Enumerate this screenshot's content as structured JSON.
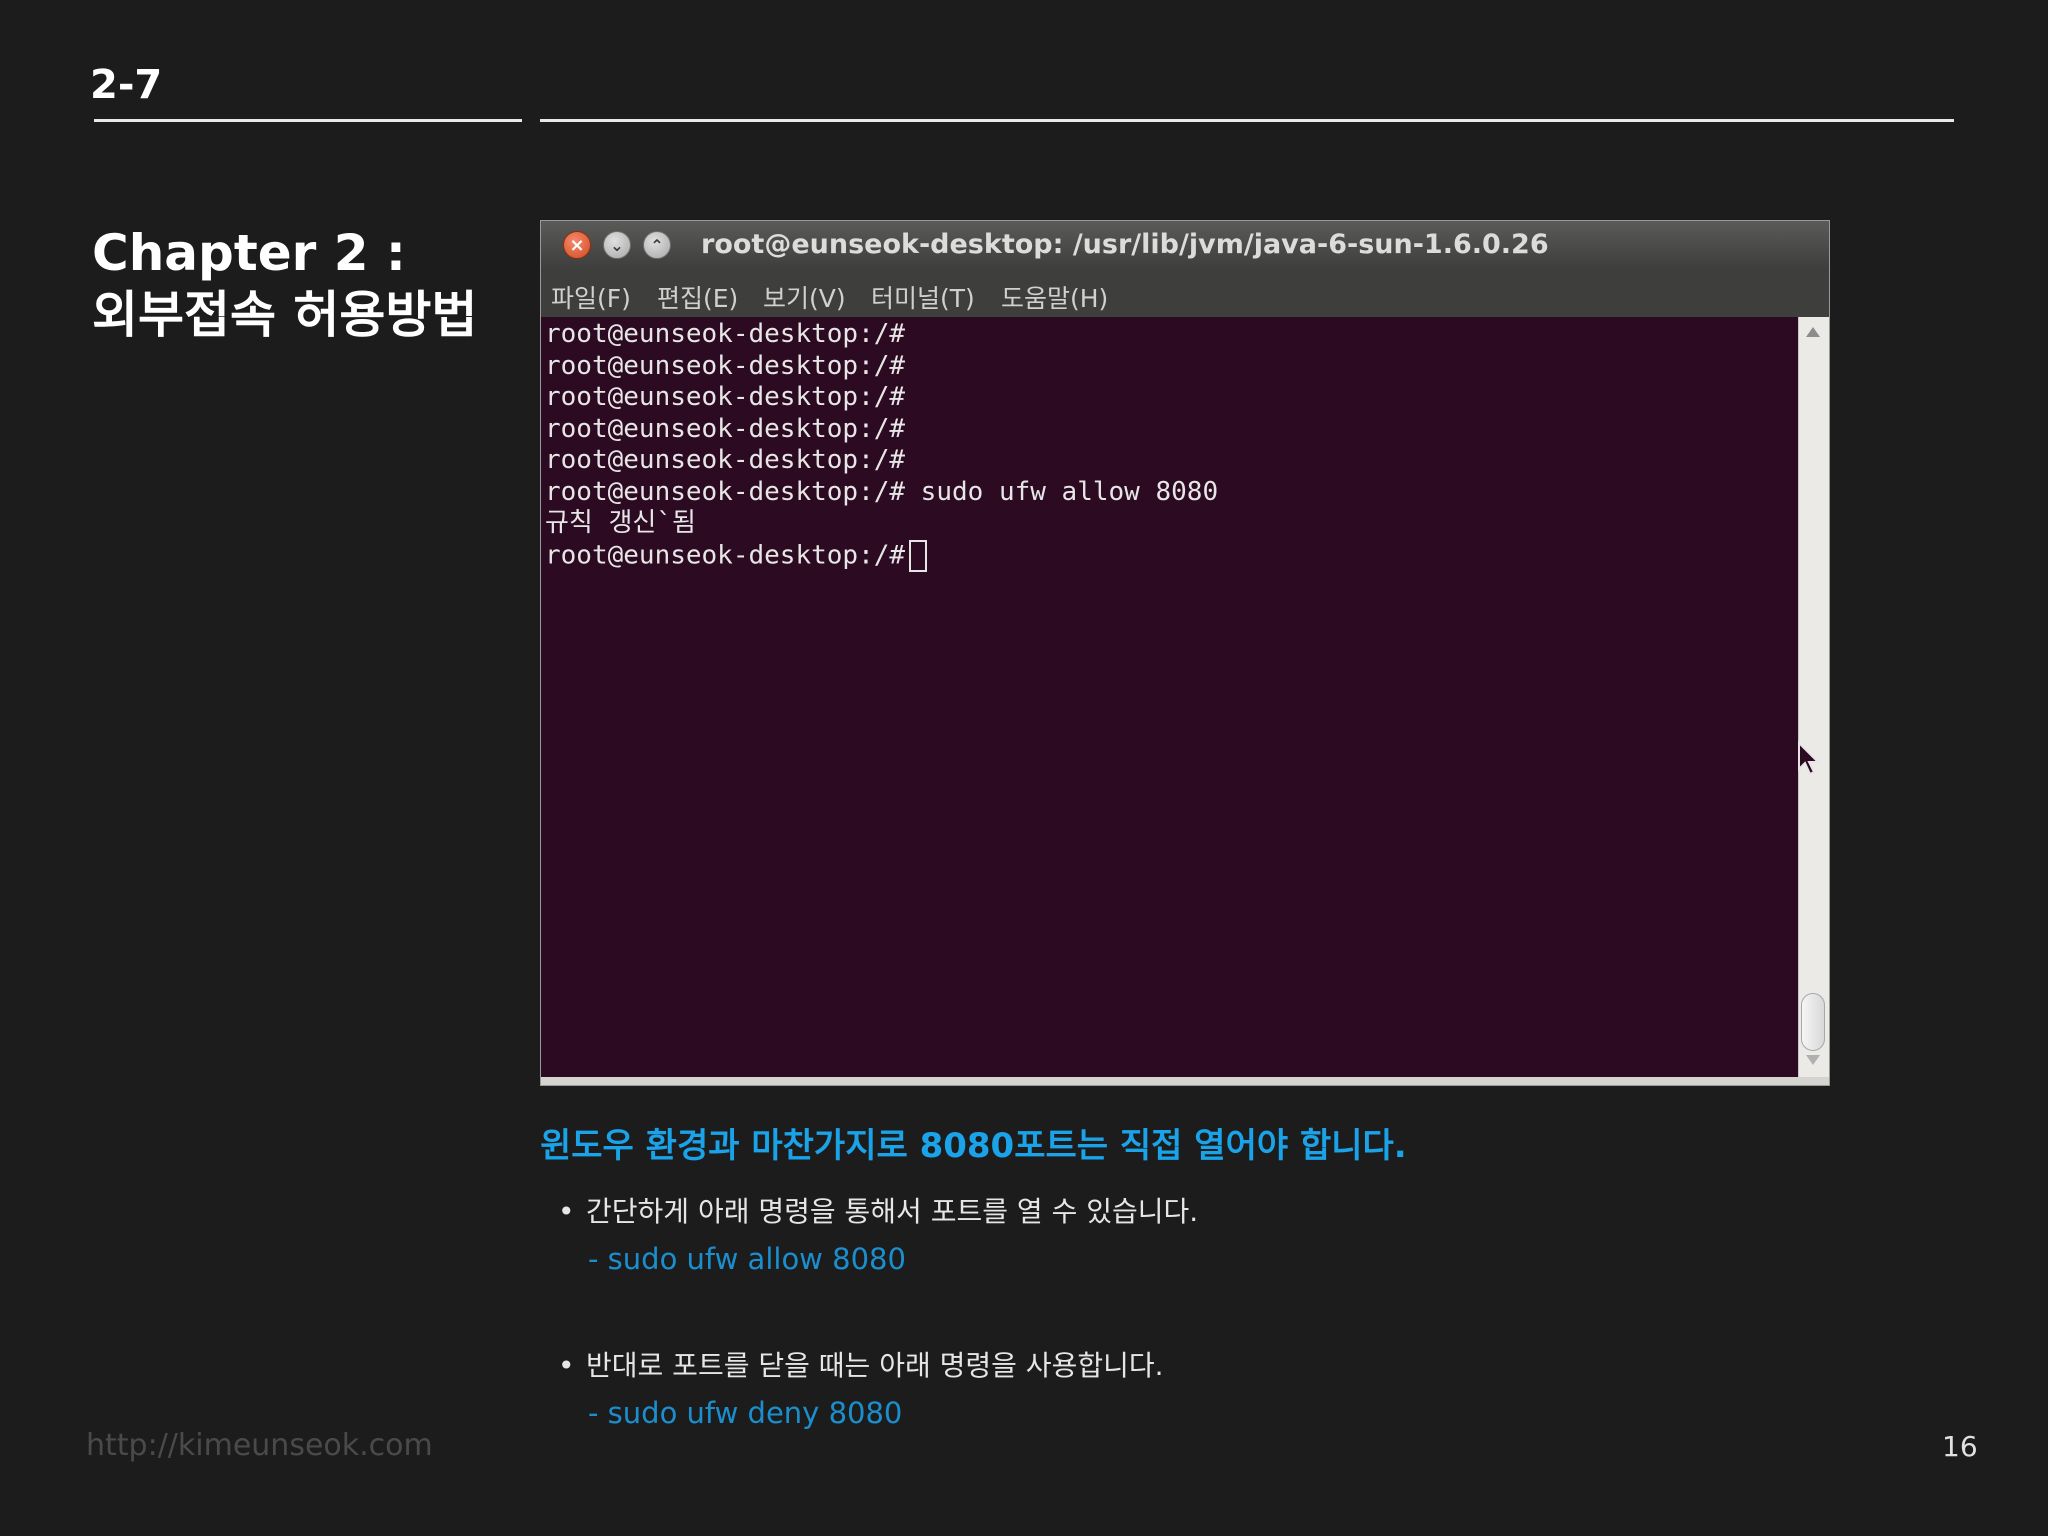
{
  "slide": {
    "section_number": "2-7",
    "chapter_title_line1": "Chapter 2 :",
    "chapter_title_line2": "외부접속 허용방법",
    "footer_url": "http://kimeunseok.com",
    "page_number": "16"
  },
  "terminal": {
    "window_title": "root@eunseok-desktop: /usr/lib/jvm/java-6-sun-1.6.0.26",
    "close_glyph": "×",
    "minimize_glyph": "⌄",
    "maximize_glyph": "⌃",
    "menu": [
      "파일(F)",
      "편집(E)",
      "보기(V)",
      "터미널(T)",
      "도움말(H)"
    ],
    "lines": [
      "root@eunseok-desktop:/#",
      "root@eunseok-desktop:/#",
      "root@eunseok-desktop:/#",
      "root@eunseok-desktop:/#",
      "root@eunseok-desktop:/#",
      "root@eunseok-desktop:/# sudo ufw allow 8080",
      "규칙 갱신`됨",
      "root@eunseok-desktop:/#"
    ],
    "background_color": "#2c0a22",
    "icons": [
      "close-icon",
      "minimize-icon",
      "maximize-icon",
      "mouse-pointer-icon"
    ]
  },
  "content": {
    "headline": "윈도우 환경과 마찬가지로 8080포트는 직접 열어야 합니다.",
    "bullet_symbol": "•",
    "bullets": [
      {
        "text": "간단하게 아래 명령을 통해서 포트를 열 수 있습니다.",
        "command": "- sudo ufw allow 8080"
      },
      {
        "text": "반대로 포트를 닫을 때는 아래 명령을 사용합니다.",
        "command": "- sudo ufw deny 8080"
      }
    ],
    "headline_color": "#1aa3e8",
    "command_color": "#1b8fce"
  }
}
